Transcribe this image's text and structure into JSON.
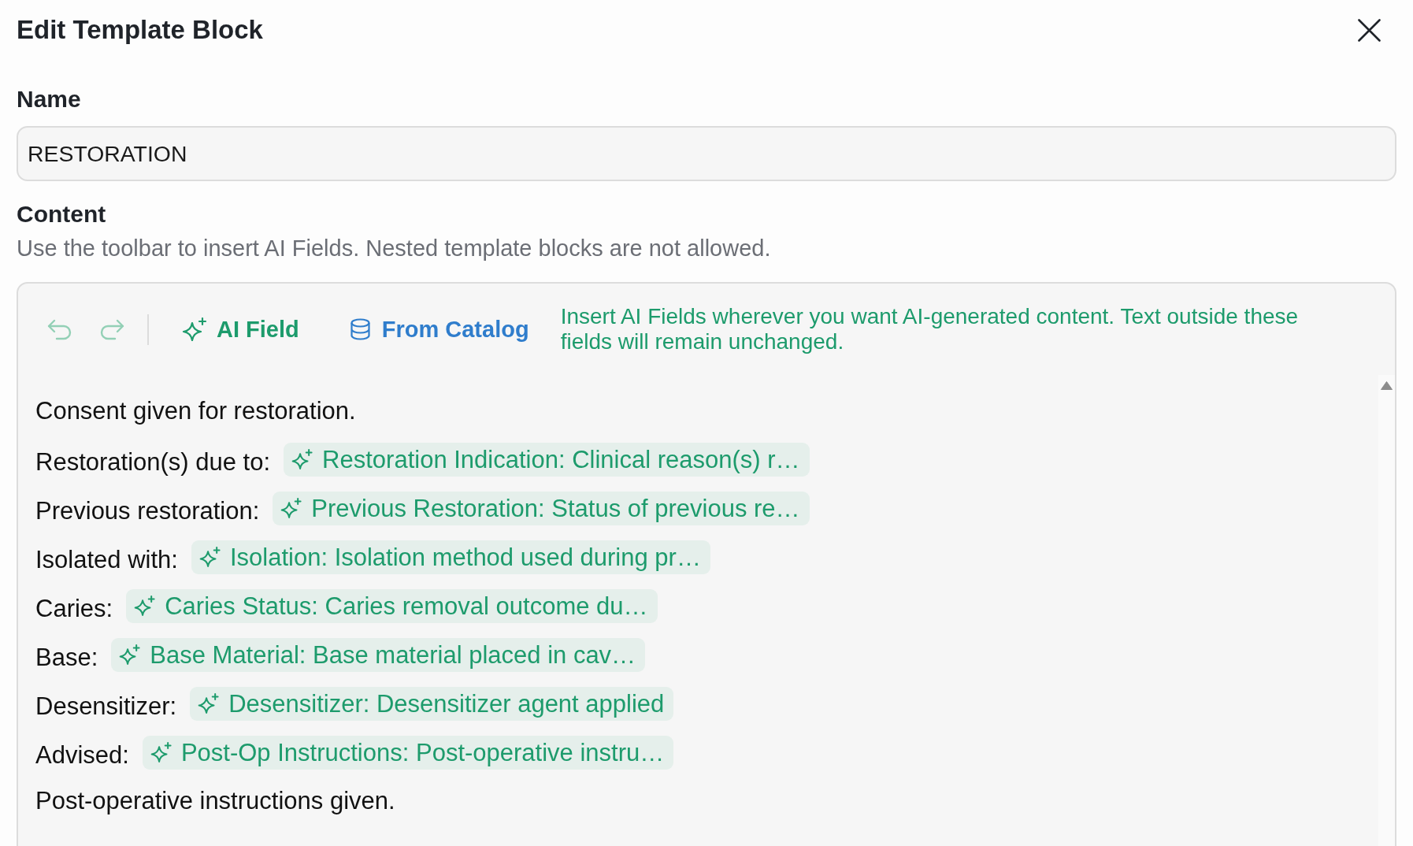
{
  "dialog": {
    "title": "Edit Template Block"
  },
  "name_field": {
    "label": "Name",
    "value": "RESTORATION"
  },
  "content": {
    "label": "Content",
    "help": "Use the toolbar to insert AI Fields. Nested template blocks are not allowed.",
    "toolbar": {
      "undo": {
        "disabled": true
      },
      "redo": {
        "disabled": true
      },
      "buttons": [
        {
          "kind": "ai_field",
          "label": "AI Field"
        },
        {
          "kind": "catalog",
          "label": "From Catalog"
        }
      ],
      "hint": "Insert AI Fields wherever you want AI-generated content. Text outside these fields will remain unchanged."
    },
    "lines": [
      {
        "kind": "text",
        "text": "Consent given for restoration."
      },
      {
        "kind": "field",
        "label": "Restoration(s) due to:",
        "field": "Restoration Indication: Clinical reason(s) r…"
      },
      {
        "kind": "field",
        "label": "Previous restoration:",
        "field": "Previous Restoration: Status of previous re…"
      },
      {
        "kind": "field",
        "label": "Isolated with:",
        "field": "Isolation: Isolation method used during pr…"
      },
      {
        "kind": "field",
        "label": "Caries:",
        "field": "Caries Status: Caries removal outcome du…"
      },
      {
        "kind": "field",
        "label": "Base:",
        "field": "Base Material: Base material placed in cav…"
      },
      {
        "kind": "field",
        "label": "Desensitizer:",
        "field": "Desensitizer: Desensitizer agent applied"
      },
      {
        "kind": "field",
        "label": "Advised:",
        "field": "Post-Op Instructions: Post-operative instru…"
      },
      {
        "kind": "text",
        "text": "Post-operative instructions given."
      }
    ]
  }
}
